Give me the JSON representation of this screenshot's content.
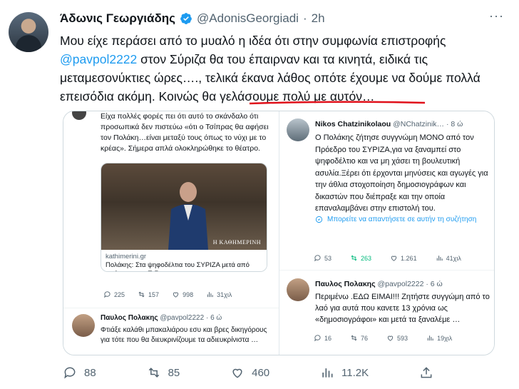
{
  "author": {
    "name": "Άδωνις Γεωργιάδης",
    "handle": "@AdonisGeorgiadi",
    "separator": "·",
    "time": "2h",
    "more": "···"
  },
  "tweet": {
    "text_before": "Μου είχε περάσει από το μυαλό η ιδέα ότι στην συμφωνία επιστροφής ",
    "mention": "@pavpol2222",
    "text_after": " στον Σύριζα θα του έπαιρναν και τα κινητά, ειδικά τις μεταμεσονύκτιες ώρες…., τελικά έκανα λάθος οπότε έχουμε να δούμε πολλά επεισόδια ακόμη. Κοινώς θα γελάσουμε πολύ με αυτόν…"
  },
  "left_card": {
    "text": "Είχα πολλές φορές πει ότι αυτό το σκάνδαλο ότι προσωπικά δεν πιστεύω «ότι ο Τσίπρας θα αφήσει τον Πολάκη…είναι μεταξύ τους όπως το νύχι με το κρέας». Σήμερα απλά ολοκληρώθηκε το θέατρο.",
    "photo_watermark": "Η ΚΑΘΗΜΕΡΙΝΗ",
    "link_domain": "kathimerini.gr",
    "link_title": "Πολάκης: Στα ψηφοδέλτια του ΣΥΡΙΖΑ μετά από απόφαση της Π.Γ.",
    "actions": {
      "replies": "225",
      "retweets": "157",
      "likes": "998",
      "views": "31χιλ"
    },
    "reply": {
      "name": "Παυλος Πολακης",
      "handle": "@pavpol2222",
      "time": "· 6 ώ",
      "text": "Φτιάξε καλάθι μπακαλιάρου εσυ και βρες δικηγόρους για τότε που θα διευκρινίζουμε τα αδιευκρίνιστα …"
    }
  },
  "right_card": {
    "first": {
      "name": "Nikos Chatzinikolaou",
      "handle": "@NChatzinik…",
      "time": "· 8 ώ",
      "text": "Ο Πολάκης ζήτησε συγγνώμη ΜΟΝΟ από τον Πρόεδρο του ΣΥΡΙΖΑ,για να ξαναμπεί στο ψηφοδέλτιο και να μη χάσει τη βουλευτική ασυλία.Ξέρει ότι έρχονται μηνύσεις και αγωγές για την άθλια στοχοποίηση δημοσιογράφων και δικαστών που διέπραξε και την οποία επαναλαμβάνει στην επιστολή του.",
      "reply_hint": "Μπορείτε να απαντήσετε σε αυτήν τη συζήτηση",
      "actions": {
        "replies": "53",
        "retweets": "263",
        "likes": "1.261",
        "views": "41χιλ"
      }
    },
    "second": {
      "name": "Παυλος Πολακης",
      "handle": "@pavpol2222",
      "time": "· 6 ώ",
      "text": "Περιμένω .ΕΔΩ ΕΙΜΑΙ!!! Ζητήστε συγγώμη από το λαό για αυτά που κανετε 13 χρόνια ως «δημοσιογράφοι» και μετά τα ξαναλέμε …",
      "actions": {
        "replies": "16",
        "retweets": "76",
        "likes": "593",
        "views": "19χιλ"
      }
    }
  },
  "actions": {
    "replies": "88",
    "retweets": "85",
    "likes": "460",
    "views": "11.2K"
  },
  "colors": {
    "accent": "#1d9bf0",
    "muted": "#536471",
    "retweet_green": "#00ba7c",
    "underline_red": "#e0101a"
  },
  "icons": [
    "verified-badge-icon",
    "more-icon",
    "reply-icon",
    "retweet-icon",
    "like-icon",
    "views-icon",
    "share-icon",
    "reply-info-icon"
  ]
}
